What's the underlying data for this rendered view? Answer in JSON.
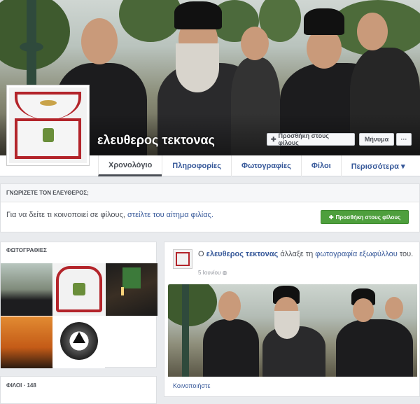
{
  "profile": {
    "name": "ελευθερος τεκτονας"
  },
  "cover_buttons": {
    "add_friend": "Προσθήκη στους φίλους",
    "message": "Μήνυμα",
    "more": "···"
  },
  "nav": {
    "tabs": [
      "Χρονολόγιο",
      "Πληροφορίες",
      "Φωτογραφίες",
      "Φίλοι",
      "Περισσότερα ▾"
    ]
  },
  "know_box": {
    "header": "ΓΝΩΡΙΖΕΤΕ ΤΟΝ ΕΛΕΥΘΕΡΟΣ;",
    "message_prefix": "Για να δείτε τι κοινοποιεί σε φίλους,",
    "message_link": "στείλτε του αίτημα φιλίας.",
    "button": "Προσθήκη στους φίλους"
  },
  "photos_box": {
    "header": "ΦΩΤΟΓΡΑΦΙΕΣ"
  },
  "friends_box": {
    "header": "ΦΙΛΟΙ · 148"
  },
  "post": {
    "prefix": "Ο",
    "name": "ελευθερος τεκτονας",
    "verb": "άλλαξε τη",
    "link": "φωτογραφία εξωφύλλου",
    "suffix": "του.",
    "date": "5 Ιουνίου",
    "share": "Κοινοποιήστε"
  },
  "colors": {
    "link": "#365899",
    "green_button": "#4e9f3d",
    "apron_red": "#b3242a",
    "background": "#e9ebee"
  },
  "icons": {
    "add_friend": "person-plus-icon",
    "globe": "globe-icon"
  }
}
